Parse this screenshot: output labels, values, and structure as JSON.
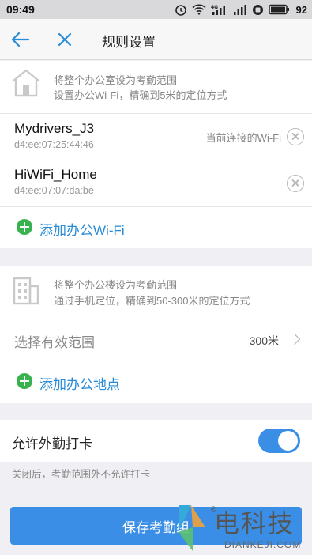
{
  "status_bar": {
    "time": "09:49",
    "battery": "92",
    "icons": [
      "alarm-icon",
      "wifi-icon",
      "signal-4g-icon",
      "signal-icon",
      "data-saver-icon",
      "battery-icon"
    ]
  },
  "nav": {
    "title": "规则设置",
    "back_icon": "arrow-left-icon",
    "close_icon": "close-icon",
    "accent_color": "#2a8bd6"
  },
  "wifi_section": {
    "hint_line1": "将整个办公室设为考勤范围",
    "hint_line2": "设置办公Wi-Fi，精确到5米的定位方式",
    "networks": [
      {
        "name": "Mydrivers_J3",
        "mac": "d4:ee:07:25:44:46",
        "status": "当前连接的Wi-Fi"
      },
      {
        "name": "HiWiFi_Home",
        "mac": "d4:ee:07:07:da:be",
        "status": ""
      }
    ],
    "add_label": "添加办公Wi-Fi"
  },
  "location_section": {
    "hint_line1": "将整个办公楼设为考勤范围",
    "hint_line2": "通过手机定位，精确到50-300米的定位方式",
    "range_label": "选择有效范围",
    "range_value": "300米",
    "add_label": "添加办公地点"
  },
  "outside_section": {
    "toggle_label": "允许外勤打卡",
    "toggle_on": true,
    "hint": "关闭后，考勤范围外不允许打卡"
  },
  "save_button": {
    "label": "保存考勤组",
    "color": "#3b8ee6"
  },
  "watermark": {
    "text": "电科技",
    "sub": "DIANKEJI.COM",
    "reg": "®"
  }
}
